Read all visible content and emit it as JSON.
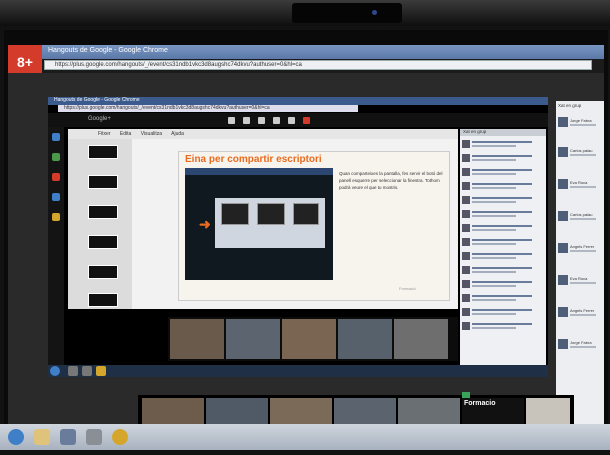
{
  "browser": {
    "title": "Hangouts de Google - Google Chrome",
    "url": "https://plus.google.com/hangouts/_/event/cs31ndb1vkc3d8augshc74dkvu?authuser=0&hl=ca",
    "inner_title": "Hangouts de Google - Google Chrome",
    "inner_url": "https://plus.google.com/hangouts/_/event/cs31ndb1vkc3d8augshc74dkvu?authuser=0&hl=ca",
    "google_tab": "8+",
    "hangout_label": "Google+"
  },
  "docs": {
    "menu": [
      "Fitxer",
      "Edita",
      "Visualitza",
      "Ajuda"
    ]
  },
  "slide": {
    "title": "Eina per compartir escriptori",
    "text": "Quan comparteixes la pantalla, fes servir el botó del panell esquerre per seleccionar la finestra. Tothom podrà veure el que tu mostris.",
    "footer": "Formació"
  },
  "chat": {
    "header": "Xat en grup"
  },
  "right_panel": {
    "header": "Xat en grup",
    "names": [
      "Jorge Fabra",
      "Carlos palau",
      "Eva Roca",
      "Carlos palau",
      "Angels Ferrer",
      "Eva Roca",
      "Angels Ferrer",
      "Jorge Fabra"
    ]
  },
  "video": {
    "label": "Formacio"
  },
  "colors": {
    "slide_title": "#e86b1f",
    "google_red": "#d43b2b",
    "end_call": "#e2533e"
  }
}
